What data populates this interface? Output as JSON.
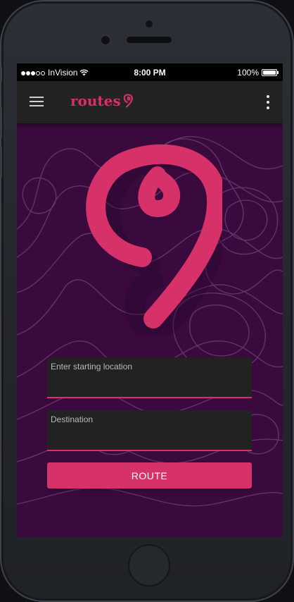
{
  "status_bar": {
    "carrier": "InVision",
    "time": "8:00 PM",
    "battery": "100%",
    "battery_level": 1.0
  },
  "app_bar": {
    "brand": "routes",
    "menu_icon": "hamburger-menu-icon",
    "overflow_icon": "more-vert-icon"
  },
  "form": {
    "start_label": "Enter starting location",
    "start_value": "",
    "destination_label": "Destination",
    "destination_value": "",
    "route_button": "ROUTE"
  },
  "colors": {
    "accent": "#d63168",
    "background": "#3a0a3f",
    "app_bar": "#232323",
    "field": "#222222"
  }
}
